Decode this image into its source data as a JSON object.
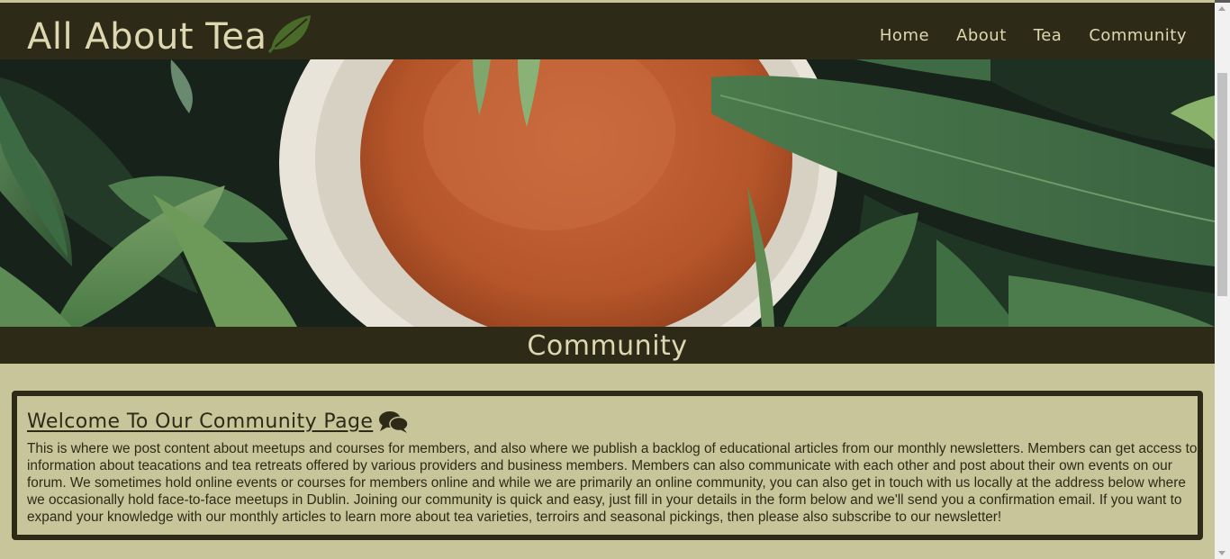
{
  "header": {
    "brand": "All About Tea",
    "brand_icon": "leaf-icon",
    "nav": [
      {
        "label": "Home"
      },
      {
        "label": "About"
      },
      {
        "label": "Tea"
      },
      {
        "label": "Community"
      }
    ]
  },
  "hero": {
    "image": "tea-cup-leaves-image"
  },
  "section": {
    "title": "Community"
  },
  "welcome": {
    "heading": "Welcome To Our Community Page",
    "heading_icon": "comments-icon",
    "body": "This is where we post content about meetups and courses for members, and also where we publish a backlog of educational articles from our monthly newsletters. Members can get access to information about teacations and tea retreats offered by various providers and business members. Members can also communicate with each other and post about their own events on our forum. We sometimes hold online events or courses for members online and while we are primarily an online community, you can also get in touch with us locally at the address below where we occasionally hold face-to-face meetups in Dublin. Joining our community is quick and easy, just fill in your details in the form below and we'll send you a confirmation email. If you want to expand your knowledge with our monthly articles to learn more about tea varieties, terroirs and seasonal pickings, then please also subscribe to our newsletter!"
  },
  "colors": {
    "dark": "#2d2a18",
    "cream": "#ddd8b0",
    "background": "#c9c59a"
  }
}
